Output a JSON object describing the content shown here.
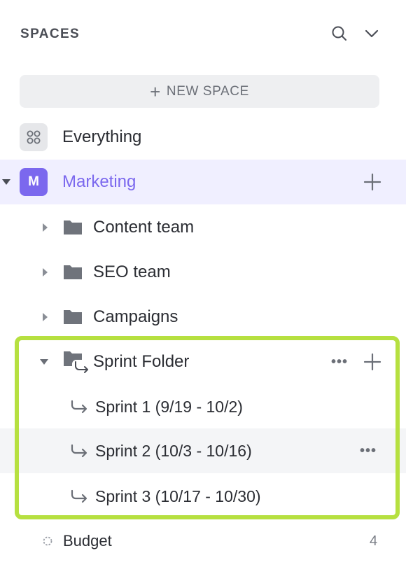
{
  "header": {
    "title": "SPACES"
  },
  "new_space": {
    "label": "NEW SPACE"
  },
  "everything": {
    "label": "Everything"
  },
  "space": {
    "initial": "M",
    "name": "Marketing",
    "accent": "#7b68ee"
  },
  "folders": [
    {
      "label": "Content team"
    },
    {
      "label": "SEO team"
    },
    {
      "label": "Campaigns"
    }
  ],
  "sprint_folder": {
    "label": "Sprint Folder",
    "sprints": [
      {
        "label": "Sprint 1 (9/19 - 10/2)"
      },
      {
        "label": "Sprint 2 (10/3 - 10/16)"
      },
      {
        "label": "Sprint 3 (10/17 - 10/30)"
      }
    ]
  },
  "budget": {
    "label": "Budget",
    "count": "4"
  },
  "colors": {
    "highlight": "#b6e040",
    "accent": "#7b68ee"
  },
  "icons": [
    "search-icon",
    "chevron-down-icon",
    "plus-icon",
    "grid-icon",
    "folder-icon",
    "sprint-folder-icon",
    "sprint-icon",
    "more-icon",
    "caret-right-icon",
    "caret-down-icon",
    "list-status-icon"
  ]
}
